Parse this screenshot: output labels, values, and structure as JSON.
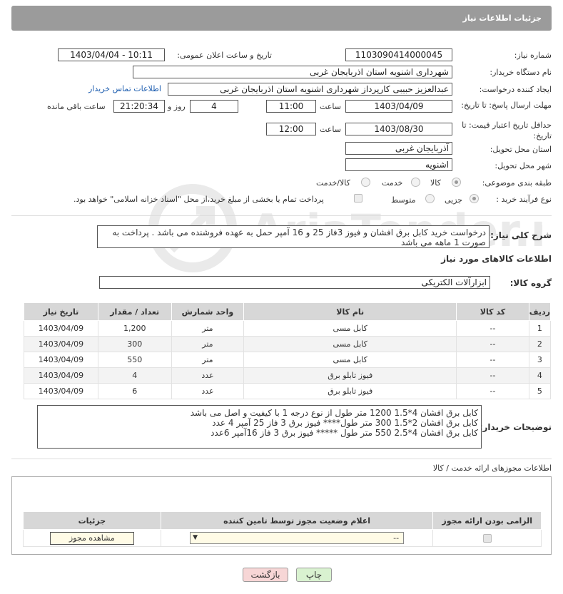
{
  "header": {
    "title": "جزئیات اطلاعات نیاز"
  },
  "form": {
    "need_number_label": "شماره نیاز:",
    "need_number": "1103090414000045",
    "announce_label": "تاریخ و ساعت اعلان عمومی:",
    "announce_value": "1403/04/04 - 10:11",
    "buyer_org_label": "نام دستگاه خریدار:",
    "buyer_org": "شهرداری اشنویه استان اذربایجان غربی",
    "requester_label": "ایجاد کننده درخواست:",
    "requester": "عبدالعزیز حبیبی کارپرداز شهرداری اشنویه استان اذربایجان غربی",
    "buyer_contact_link": "اطلاعات تماس خریدار",
    "deadline_label": "مهلت ارسال پاسخ: تا تاریخ:",
    "deadline_date": "1403/04/09",
    "time_label": "ساعت",
    "deadline_time": "11:00",
    "days_value": "4",
    "days_label": "روز و",
    "remaining_time": "21:20:34",
    "remaining_label": "ساعت باقی مانده",
    "price_validity_label": "حداقل تاریخ اعتبار قیمت: تا تاریخ:",
    "price_validity_date": "1403/08/30",
    "price_validity_time": "12:00",
    "province_label": "استان محل تحویل:",
    "province": "آذربایجان غربی",
    "city_label": "شهر محل تحویل:",
    "city": "اشنویه",
    "category_label": "طبقه بندی موضوعی:",
    "category_options": [
      "کالا",
      "خدمت",
      "کالا/خدمت"
    ],
    "process_label": "نوع فرآیند خرید :",
    "process_options": [
      "جزیی",
      "متوسط"
    ],
    "payment_note": "پرداخت تمام یا بخشی از مبلغ خرید،از محل \"اسناد خزانه اسلامی\" خواهد بود."
  },
  "description": {
    "label": "شرح کلی نیاز:",
    "text": "درخواست خرید کابل برق افشان و فیوز 3فاز 25 و 16 آمپر حمل به عهده فروشنده می باشد . پرداخت به صورت 1 ماهه می باشد"
  },
  "goods": {
    "section_title": "اطلاعات کالاهای مورد نیاز",
    "group_label": "گروه کالا:",
    "group_value": "ابزارآلات الکتریکی",
    "columns": [
      "ردیف",
      "کد کالا",
      "نام کالا",
      "واحد شمارش",
      "تعداد / مقدار",
      "تاریخ نیاز"
    ],
    "rows": [
      [
        "1",
        "--",
        "کابل مسی",
        "متر",
        "1,200",
        "1403/04/09"
      ],
      [
        "2",
        "--",
        "کابل مسی",
        "متر",
        "300",
        "1403/04/09"
      ],
      [
        "3",
        "--",
        "کابل مسی",
        "متر",
        "550",
        "1403/04/09"
      ],
      [
        "4",
        "--",
        "فیوز تابلو برق",
        "عدد",
        "4",
        "1403/04/09"
      ],
      [
        "5",
        "--",
        "فیوز تابلو برق",
        "عدد",
        "6",
        "1403/04/09"
      ]
    ]
  },
  "buyer_notes": {
    "label": "توضیحات خریدار:",
    "lines": [
      "کابل برق افشان 4*1.5 1200 متر طول  از نوع درجه 1 با کیفیت و اصل می باشد",
      "کابل برق افشان 2*1.5 300 متر طول**** فیوز برق 3 فاز 25 آمپر 4 عدد",
      "کابل برق افشان 4*2.5 550 متر طول ***** فیوز برق 3 فاز 16آمپر 6عدد"
    ]
  },
  "permits": {
    "section_title": "اطلاعات مجوزهای ارائه خدمت / کالا",
    "columns": [
      "الزامی بودن ارائه مجوز",
      "اعلام وضعیت مجوز توسط تامین کننده",
      "جزئیات"
    ],
    "select_value": "--",
    "view_button": "مشاهده مجوز"
  },
  "actions": {
    "print": "چاپ",
    "back": "بازگشت"
  },
  "watermark": "AriaTender.neT",
  "colors": {
    "header": "#9b9b9b",
    "link": "#1f5fb0",
    "back_button": "#f7d6d6",
    "print_button": "#d9f2d0"
  }
}
